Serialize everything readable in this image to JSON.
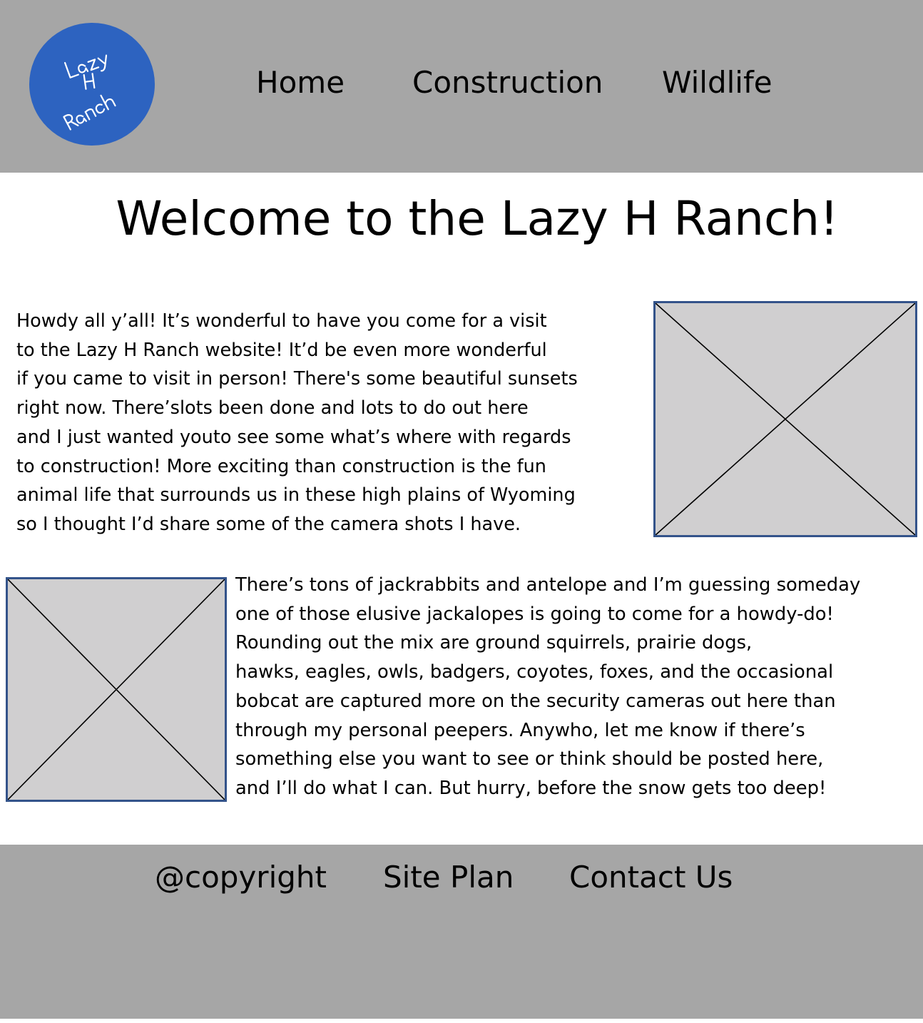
{
  "header": {
    "logo": {
      "lines": [
        "Lazy",
        "H",
        "Ranch"
      ],
      "background_color": "#2d63c0",
      "text_color": "#ffffff"
    },
    "nav": [
      {
        "label": "Home"
      },
      {
        "label": "Construction"
      },
      {
        "label": "Wildlife"
      }
    ],
    "background_color": "#a6a6a6"
  },
  "main": {
    "title": "Welcome to the Lazy H Ranch!",
    "intro_lines": [
      "Howdy all y’all! It’s wonderful to have you come for a visit",
      "to the Lazy H Ranch website! It’d be even more wonderful",
      "if you came to visit in person! There's some beautiful sunsets",
      "right now. There’slots been done and lots to do out here",
      "and I just wanted youto see some what’s where with regards",
      "to construction! More exciting than construction is the fun",
      "animal life that surrounds us in these  high plains of Wyoming",
      "so I thought I’d share some of the camera shots I have."
    ],
    "wildlife_lines": [
      "There’s tons of jackrabbits and antelope and I’m guessing someday",
      "one of those elusive jackalopes is going to come for a howdy-do!",
      "Rounding out the mix are ground squirrels, prairie dogs,",
      "hawks, eagles, owls, badgers, coyotes, foxes, and the occasional",
      "bobcat are captured more on the security cameras out here than",
      "through my personal peepers. Anywho, let me know if there’s",
      "something else you want to see or think should be posted here,",
      "and I’ll do what I can. But hurry, before the snow gets too deep!"
    ],
    "image_placeholder": {
      "fill_color": "#d0cfd0",
      "border_color": "#33538a"
    }
  },
  "footer": {
    "links": [
      {
        "label": "@copyright"
      },
      {
        "label": "Site Plan"
      },
      {
        "label": "Contact Us"
      }
    ],
    "background_color": "#a6a6a6"
  }
}
